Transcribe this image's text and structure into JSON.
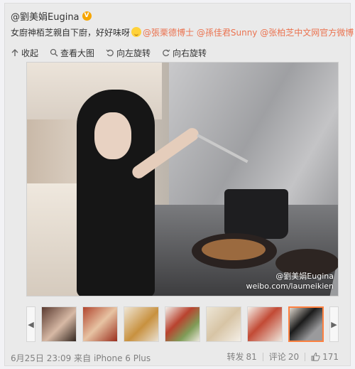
{
  "post": {
    "author": "@劉美娟Eugina",
    "verified_badge": "V",
    "text_plain": "女廚神栢芝親自下廚，好好味呀",
    "mentions": [
      "@張栗德博士",
      "@孫佳君Sunny",
      "@张柏芝中文网官方微博"
    ]
  },
  "toolbar": {
    "items": [
      {
        "label": "收起",
        "icon": "collapse-icon"
      },
      {
        "label": "查看大图",
        "icon": "zoom-icon"
      },
      {
        "label": "向左旋转",
        "icon": "rotate-left-icon"
      },
      {
        "label": "向右旋转",
        "icon": "rotate-right-icon"
      }
    ]
  },
  "photo": {
    "watermark_line1": "@劉美娟Eugina",
    "watermark_line2": "weibo.com/laumeikien"
  },
  "meta": {
    "timestamp": "6月25日 23:09",
    "source": "来自 iPhone 6 Plus"
  },
  "actions": {
    "repost_label": "转发",
    "repost_count": "81",
    "comment_label": "评论",
    "comment_count": "20",
    "like_count": "171"
  },
  "colors": {
    "mention": "#eb7350",
    "active_thumb": "#ff8140",
    "verified": "#f6a500"
  }
}
